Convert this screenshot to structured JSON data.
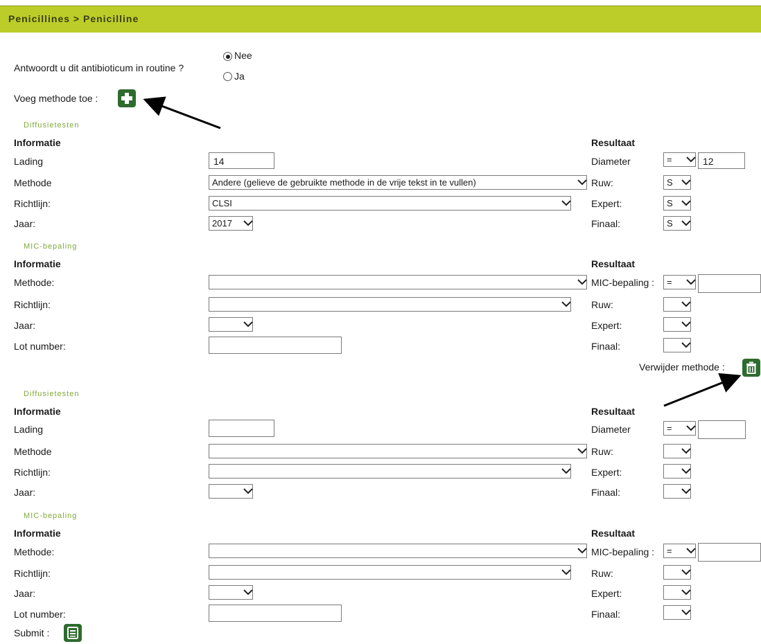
{
  "header": {
    "breadcrumb": "Penicillines > Penicilline"
  },
  "routine": {
    "question": "Antwoordt u dit antibioticum in routine ?",
    "option_nee": "Nee",
    "option_ja": "Ja",
    "selected": "Nee"
  },
  "add_method_label": "Voeg methode toe :",
  "remove_method_label": "Verwijder methode :",
  "submit_label": "Submit :",
  "colors": {
    "header": "#bccd29",
    "button": "#2e6b2e",
    "section": "#7fa83a"
  },
  "blocks": {
    "d1": {
      "section_title": "Diffusietesten",
      "info_heading": "Informatie",
      "result_heading": "Resultaat",
      "lading_label": "Lading",
      "lading_value": "14",
      "methode_label": "Methode",
      "methode_value": "Andere (gelieve de gebruikte methode in de vrije tekst in te vullen)",
      "richtlijn_label": "Richtlijn:",
      "richtlijn_value": "CLSI",
      "jaar_label": "Jaar:",
      "jaar_value": "2017",
      "diameter_label": "Diameter",
      "diameter_op": "=",
      "diameter_value": "12",
      "ruw_label": "Ruw:",
      "ruw_value": "S",
      "expert_label": "Expert:",
      "expert_value": "S",
      "finaal_label": "Finaal:",
      "finaal_value": "S"
    },
    "m1": {
      "section_title": "MIC-bepaling",
      "info_heading": "Informatie",
      "result_heading": "Resultaat",
      "methode_label": "Methode:",
      "methode_value": "",
      "richtlijn_label": "Richtlijn:",
      "richtlijn_value": "",
      "jaar_label": "Jaar:",
      "jaar_value": "",
      "lot_label": "Lot number:",
      "lot_value": "",
      "mic_label": "MIC-bepaling :",
      "mic_op": "=",
      "mic_value": "",
      "ruw_label": "Ruw:",
      "ruw_value": "",
      "expert_label": "Expert:",
      "expert_value": "",
      "finaal_label": "Finaal:",
      "finaal_value": ""
    },
    "d2": {
      "section_title": "Diffusietesten",
      "info_heading": "Informatie",
      "result_heading": "Resultaat",
      "lading_label": "Lading",
      "lading_value": "",
      "methode_label": "Methode",
      "methode_value": "",
      "richtlijn_label": "Richtlijn:",
      "richtlijn_value": "",
      "jaar_label": "Jaar:",
      "jaar_value": "",
      "diameter_label": "Diameter",
      "diameter_op": "=",
      "diameter_value": "",
      "ruw_label": "Ruw:",
      "ruw_value": "",
      "expert_label": "Expert:",
      "expert_value": "",
      "finaal_label": "Finaal:",
      "finaal_value": ""
    },
    "m2": {
      "section_title": "MIC-bepaling",
      "info_heading": "Informatie",
      "result_heading": "Resultaat",
      "methode_label": "Methode:",
      "methode_value": "",
      "richtlijn_label": "Richtlijn:",
      "richtlijn_value": "",
      "jaar_label": "Jaar:",
      "jaar_value": "",
      "lot_label": "Lot number:",
      "lot_value": "",
      "mic_label": "MIC-bepaling :",
      "mic_op": "=",
      "mic_value": "",
      "ruw_label": "Ruw:",
      "ruw_value": "",
      "expert_label": "Expert:",
      "expert_value": "",
      "finaal_label": "Finaal:",
      "finaal_value": ""
    }
  }
}
